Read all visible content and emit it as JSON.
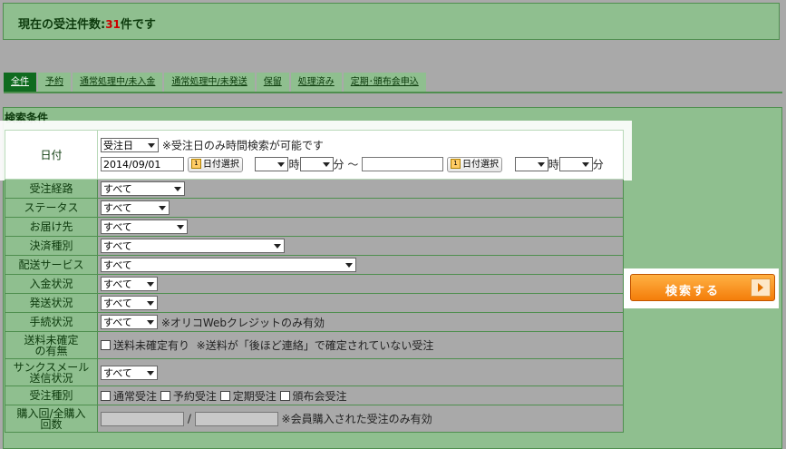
{
  "header": {
    "prefix": "現在の受注件数:",
    "count": "31",
    "suffix": "件です"
  },
  "tabs": [
    {
      "label": "全件",
      "active": true
    },
    {
      "label": "予約"
    },
    {
      "label": "通常処理中/未入金"
    },
    {
      "label": "通常処理中/未発送"
    },
    {
      "label": "保留"
    },
    {
      "label": "処理済み"
    },
    {
      "label": "定期･頒布会申込"
    }
  ],
  "panel": {
    "title": "検索条件"
  },
  "rows": {
    "date": {
      "label": "日付",
      "type_value": "受注日",
      "note": "※受注日のみ時間検索が可能です",
      "from_value": "2014/09/01",
      "cal_label": "日付選択",
      "hour_unit": "時",
      "minute_unit": "分",
      "range_sep": "～",
      "to_value": ""
    },
    "route": {
      "label": "受注経路",
      "value": "すべて"
    },
    "status": {
      "label": "ステータス",
      "value": "すべて"
    },
    "destination": {
      "label": "お届け先",
      "value": "すべて"
    },
    "payment": {
      "label": "決済種別",
      "value": "すべて"
    },
    "delivery": {
      "label": "配送サービス",
      "value": "すべて"
    },
    "deposit": {
      "label": "入金状況",
      "value": "すべて"
    },
    "shipping": {
      "label": "発送状況",
      "value": "すべて"
    },
    "procedure": {
      "label": "手続状況",
      "value": "すべて",
      "note": "※オリコWebクレジットのみ有効"
    },
    "postage": {
      "label_line1": "送料未確定",
      "label_line2": "の有無",
      "checkbox_label": "送料未確定有り",
      "note": "※送料が「後ほど連絡」で確定されていない受注"
    },
    "thanks_mail": {
      "label_line1": "サンクスメール",
      "label_line2": "送信状況",
      "value": "すべて"
    },
    "order_type": {
      "label": "受注種別",
      "options": [
        "通常受注",
        "予約受注",
        "定期受注",
        "頒布会受注"
      ]
    },
    "purchase_count": {
      "label_line1": "購入回/全購入",
      "label_line2": "回数",
      "separator": "/",
      "note": "※会員購入された受注のみ有効"
    }
  },
  "search_button": {
    "label": "検索する"
  },
  "colors": {
    "panel_green": "#8fbf8f",
    "active_tab": "#0f6b1f",
    "count_red": "#cc0000",
    "button_orange": "#f47d0a"
  }
}
